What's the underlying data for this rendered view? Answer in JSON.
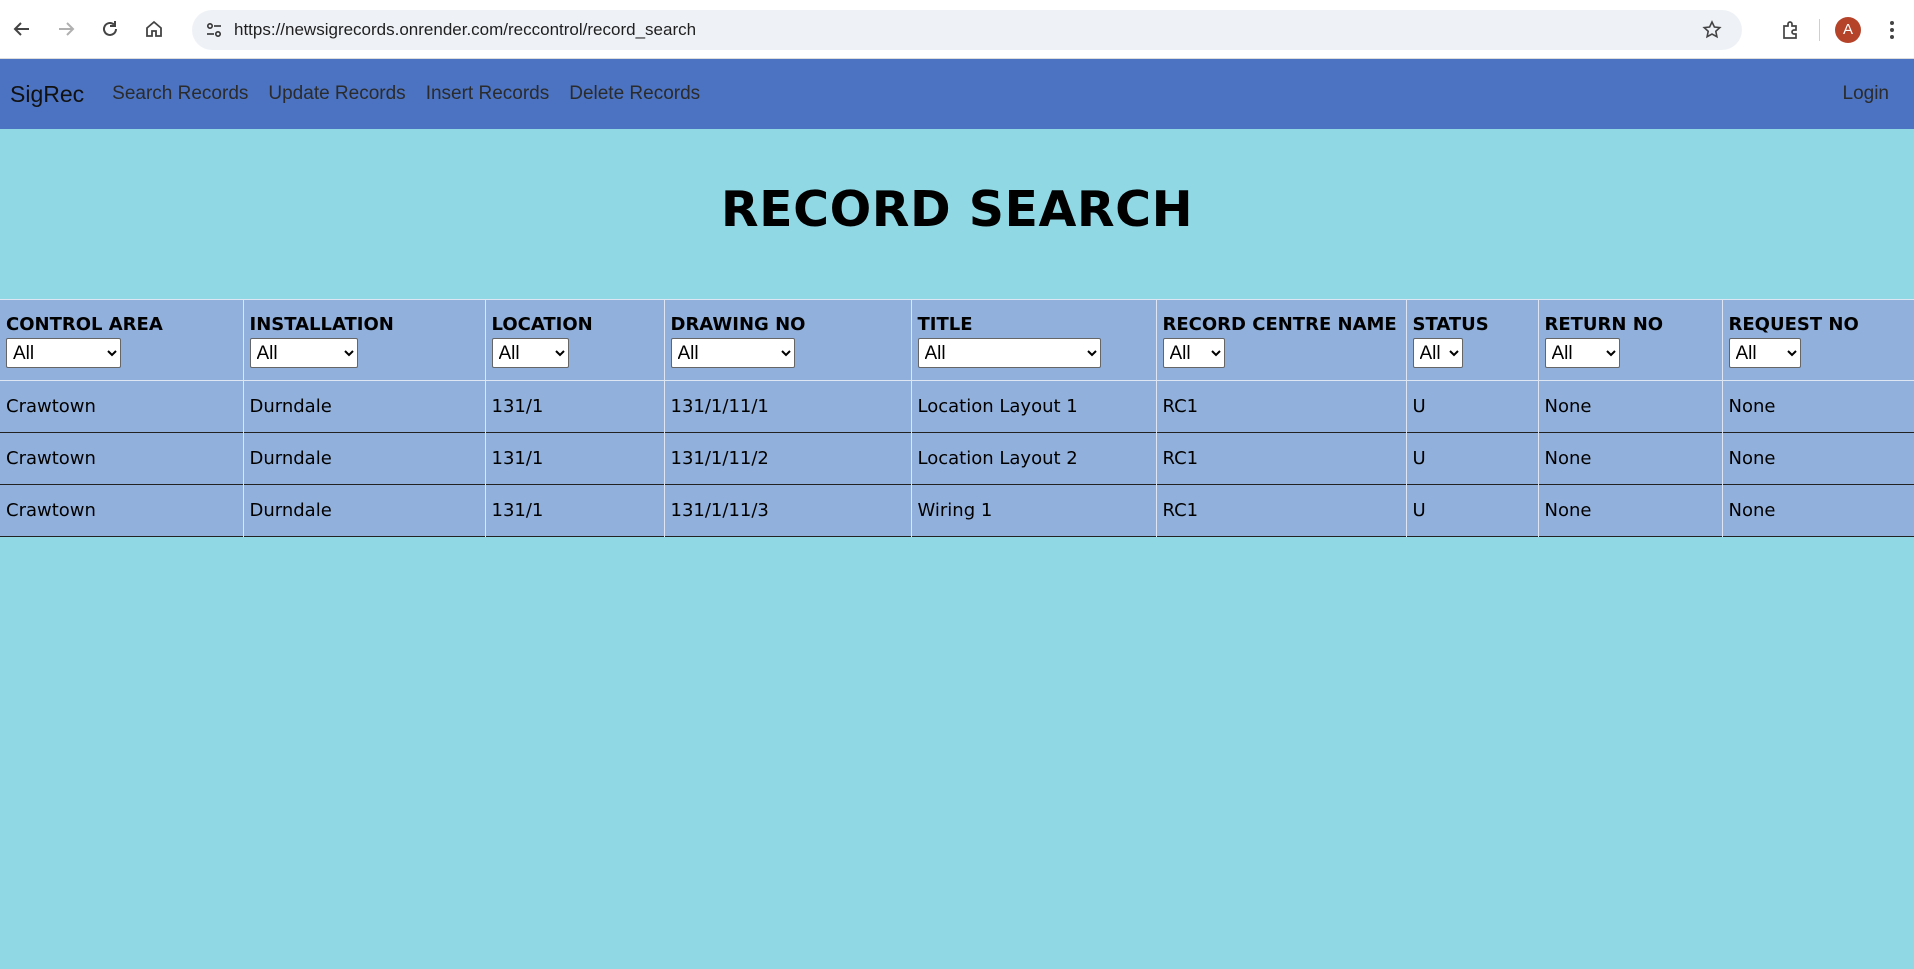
{
  "browser": {
    "url": "https://newsigrecords.onrender.com/reccontrol/record_search",
    "avatar_letter": "A"
  },
  "navbar": {
    "brand": "SigRec",
    "links": [
      "Search Records",
      "Update Records",
      "Insert Records",
      "Delete Records"
    ],
    "login": "Login"
  },
  "page": {
    "title": "RECORD SEARCH"
  },
  "table": {
    "columns": [
      {
        "label": "CONTROL AREA",
        "filter": "All"
      },
      {
        "label": "INSTALLATION",
        "filter": "All"
      },
      {
        "label": "LOCATION",
        "filter": "All"
      },
      {
        "label": "DRAWING NO",
        "filter": "All"
      },
      {
        "label": "TITLE",
        "filter": "All"
      },
      {
        "label": "RECORD CENTRE NAME",
        "filter": "All"
      },
      {
        "label": "STATUS",
        "filter": "All"
      },
      {
        "label": "RETURN NO",
        "filter": "All"
      },
      {
        "label": "REQUEST NO",
        "filter": "All"
      }
    ],
    "rows": [
      [
        "Crawtown",
        "Durndale",
        "131/1",
        "131/1/11/1",
        "Location Layout 1",
        "RC1",
        "U",
        "None",
        "None"
      ],
      [
        "Crawtown",
        "Durndale",
        "131/1",
        "131/1/11/2",
        "Location Layout 2",
        "RC1",
        "U",
        "None",
        "None"
      ],
      [
        "Crawtown",
        "Durndale",
        "131/1",
        "131/1/11/3",
        "Wiring 1",
        "RC1",
        "U",
        "None",
        "None"
      ]
    ]
  },
  "colors": {
    "page_bg": "#8fd8e4",
    "navbar_bg": "#4b73c1",
    "table_bg": "#91b0db",
    "avatar_bg": "#b5432a"
  }
}
